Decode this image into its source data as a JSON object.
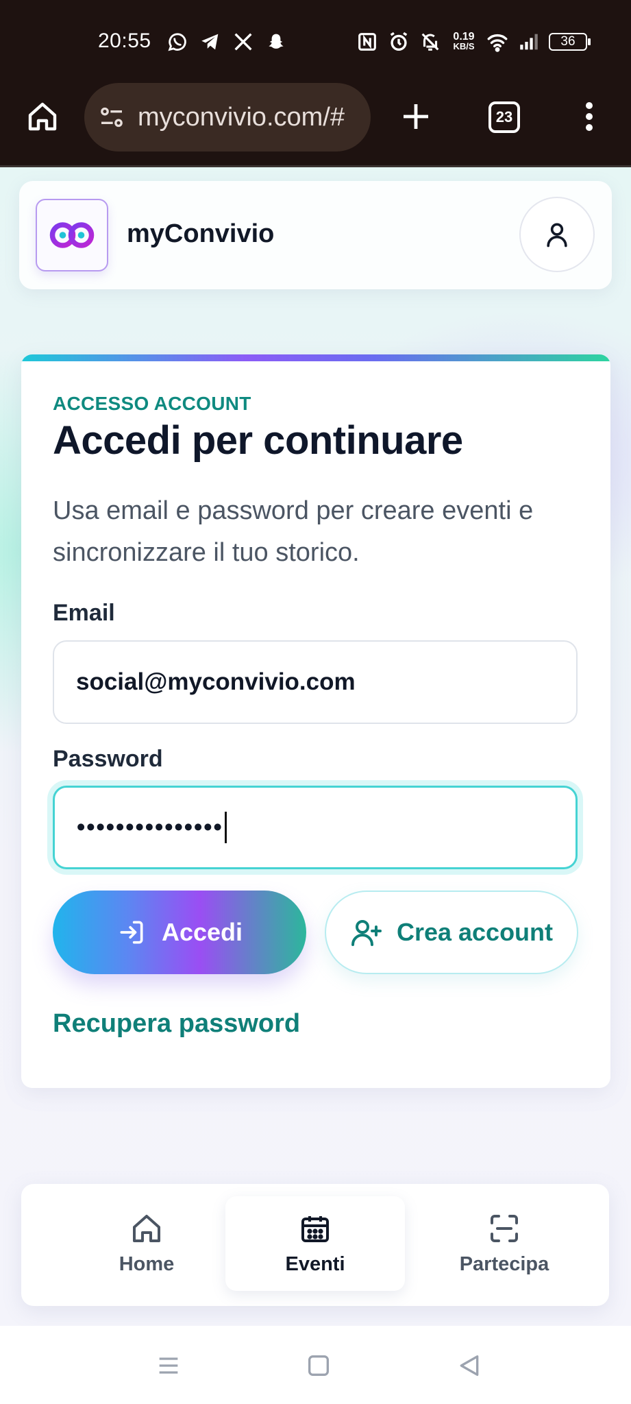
{
  "status_bar": {
    "time": "20:55",
    "net_speed_value": "0.19",
    "net_speed_unit": "KB/S",
    "battery": "36",
    "left_icons": [
      "whatsapp-icon",
      "telegram-icon",
      "x-icon",
      "snapchat-icon"
    ],
    "right_icons": [
      "nfc-icon",
      "alarm-icon",
      "mute-icon",
      "wifi-icon",
      "signal-icon"
    ]
  },
  "browser": {
    "url": "myconvivio.com/#",
    "tab_count": "23"
  },
  "app": {
    "name": "myConvivio"
  },
  "login": {
    "eyebrow": "ACCESSO ACCOUNT",
    "title": "Accedi per continuare",
    "description": "Usa email e password per creare eventi e sincronizzare il tuo storico.",
    "email_label": "Email",
    "email_value": "social@myconvivio.com",
    "password_label": "Password",
    "password_value": "•••••••••••••••",
    "login_button": "Accedi",
    "create_button": "Crea account",
    "recover_link": "Recupera password"
  },
  "bottom_nav": {
    "items": [
      {
        "label": "Home",
        "icon": "home-icon",
        "active": false
      },
      {
        "label": "Eventi",
        "icon": "calendar-icon",
        "active": true
      },
      {
        "label": "Partecipa",
        "icon": "scan-icon",
        "active": false
      }
    ]
  },
  "colors": {
    "accent_teal": "#0f7f78",
    "title_dark": "#0f172a",
    "focus_ring": "#45d3d3",
    "brand_purple": "#8b5cf6"
  }
}
